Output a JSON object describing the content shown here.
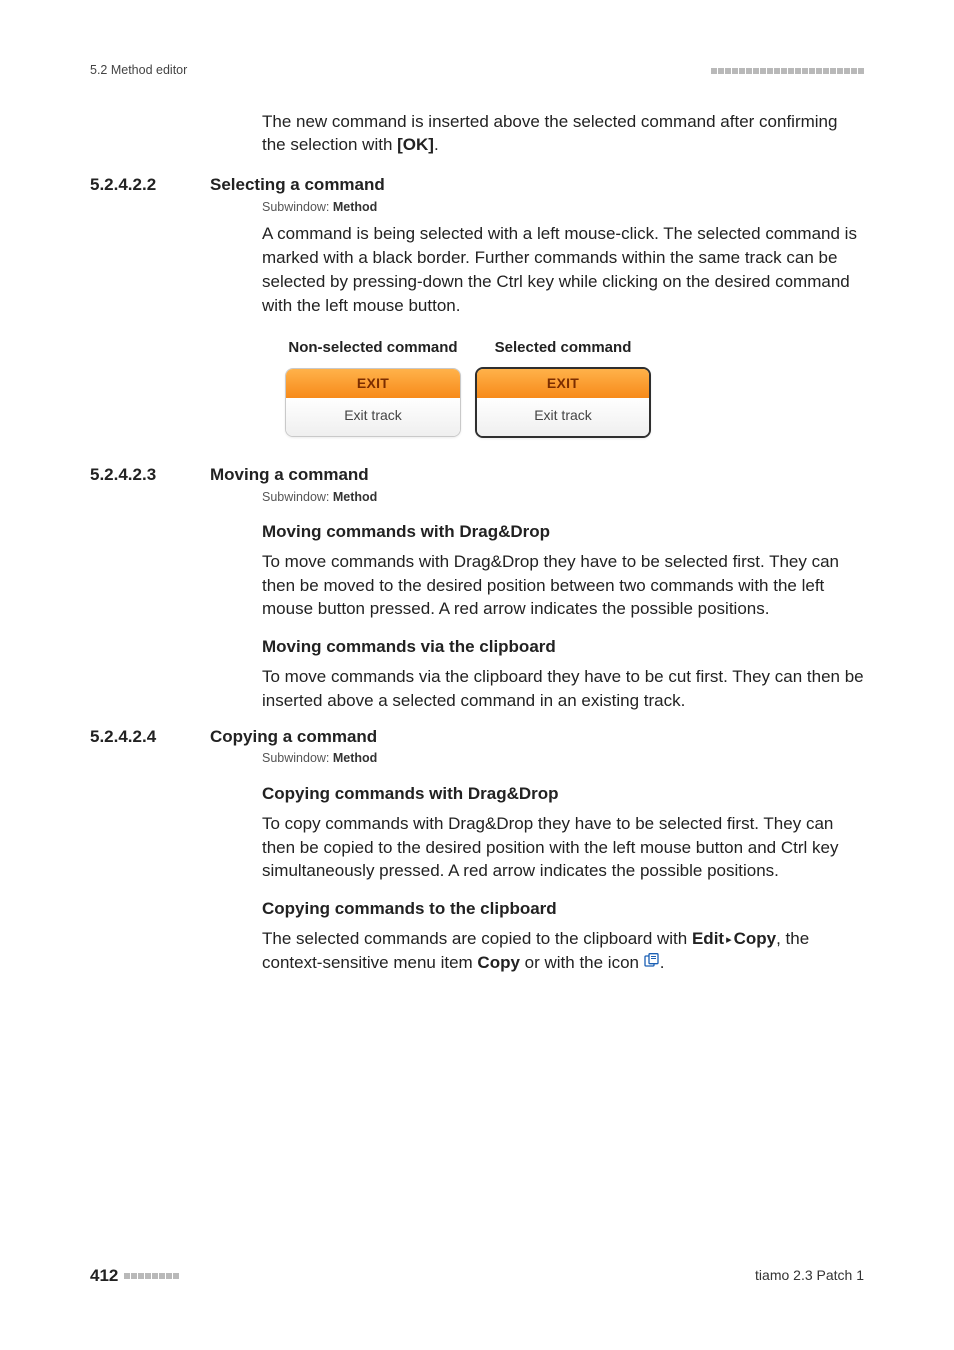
{
  "header": {
    "left": "5.2 Method editor"
  },
  "intro": {
    "text_a": "The new command is inserted above the selected command after confirm­ing the selection with ",
    "ok": "[OK]",
    "text_b": "."
  },
  "sections": {
    "s1": {
      "num": "5.2.4.2.2",
      "title": "Selecting a command",
      "subwin_label": "Subwindow: ",
      "subwin_value": "Method",
      "body": "A command is being selected with a left mouse-click. The selected com­mand is marked with a black border. Further commands within the same track can be selected by pressing-down the Ctrl key while clicking on the desired command with the left mouse button.",
      "col1": "Non-selected command",
      "col2": "Selected command",
      "box_head": "EXIT",
      "box_body": "Exit track"
    },
    "s2": {
      "num": "5.2.4.2.3",
      "title": "Moving a command",
      "subwin_label": "Subwindow: ",
      "subwin_value": "Method",
      "h4a": "Moving commands with Drag&Drop",
      "pa": "To move commands with Drag&Drop they have to be selected first. They can then be moved to the desired position between two commands with the left mouse button pressed. A red arrow indicates the possible posi­tions.",
      "h4b": "Moving commands via the clipboard",
      "pb": "To move commands via the clipboard they have to be cut first. They can then be inserted above a selected command in an existing track."
    },
    "s3": {
      "num": "5.2.4.2.4",
      "title": "Copying a command",
      "subwin_label": "Subwindow: ",
      "subwin_value": "Method",
      "h4a": "Copying commands with Drag&Drop",
      "pa": "To copy commands with Drag&Drop they have to be selected first. They can then be copied to the desired position with the left mouse button and Ctrl key simultaneously pressed. A red arrow indicates the possible posi­tions.",
      "h4b": "Copying commands to the clipboard",
      "pb1": "The selected commands are copied to the clipboard with ",
      "edit": "Edit",
      "tri": "▸",
      "copy": "Copy",
      "pb2": ", the context-sensitive menu item ",
      "copy2": "Copy",
      "pb3": " or with the icon ",
      "pb4": "."
    }
  },
  "footer": {
    "page": "412",
    "right": "tiamo 2.3 Patch 1"
  }
}
